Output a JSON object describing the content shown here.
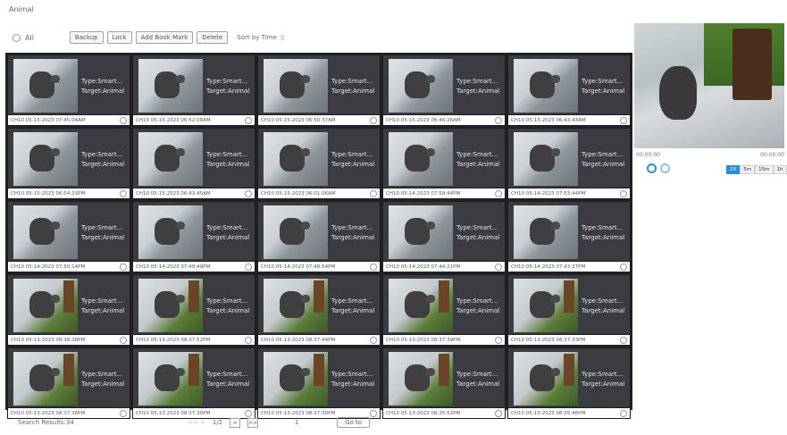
{
  "page": {
    "title": "Animal"
  },
  "toolbar": {
    "all_label": "All",
    "buttons": [
      "Backup",
      "Lock",
      "Add Book Mark",
      "Delete"
    ],
    "sort_label": "Sort by Time"
  },
  "tile_info": {
    "type": "Type:Smart...",
    "target": "Target:Animal"
  },
  "tiles": [
    "CH10 05-15-2023 07:45:04AM",
    "CH10 05-15-2023 06:52:08AM",
    "CH10 05-15-2023 06:50:37AM",
    "CH10 05-15-2023 06:46:26AM",
    "CH10 05-15-2023 06:43:43AM",
    "CH10 05-15-2023 06:54:33PM",
    "CH10 05-15-2023 06:43:45AM",
    "CH10 05-15-2023 06:01:06AM",
    "CH10 05-14-2023 07:59:44PM",
    "CH10 05-14-2023 07:53:44PM",
    "CH10 05-14-2023 07:50:14PM",
    "CH10 05-14-2023 07:49:49PM",
    "CH10 05-14-2023 07:48:54PM",
    "CH10 05-14-2023 07:44:21PM",
    "CH10 05-14-2023 07:43:37PM",
    "CH10 05-13-2023 08:38:28PM",
    "CH10 05-13-2023 08:37:52PM",
    "CH10 05-13-2023 08:37:44PM",
    "CH10 05-13-2023 08:37:39PM",
    "CH10 05-13-2023 08:37:33PM",
    "CH10 05-13-2023 08:37:36PM",
    "CH10 05-13-2023 08:37:30PM",
    "CH10 05-13-2023 08:37:30PM",
    "CH10 05-13-2023 08:35:52PM",
    "CH10 05-13-2023 08:35:46PM"
  ],
  "footer": {
    "results": "Search Results:34",
    "first_prev": "<< <",
    "page": "1/2",
    "next": ">",
    "last": ">>",
    "page_input": "1",
    "goto": "Go to"
  },
  "preview": {
    "time_start": "00:00:00",
    "time_end": "00:00:00",
    "speeds": [
      "2X",
      "5m",
      "15m",
      "1h"
    ]
  },
  "colors": {
    "accent": "#2b8fd6",
    "grid_bg": "#202226",
    "tile_bg": "#3a3c42"
  }
}
